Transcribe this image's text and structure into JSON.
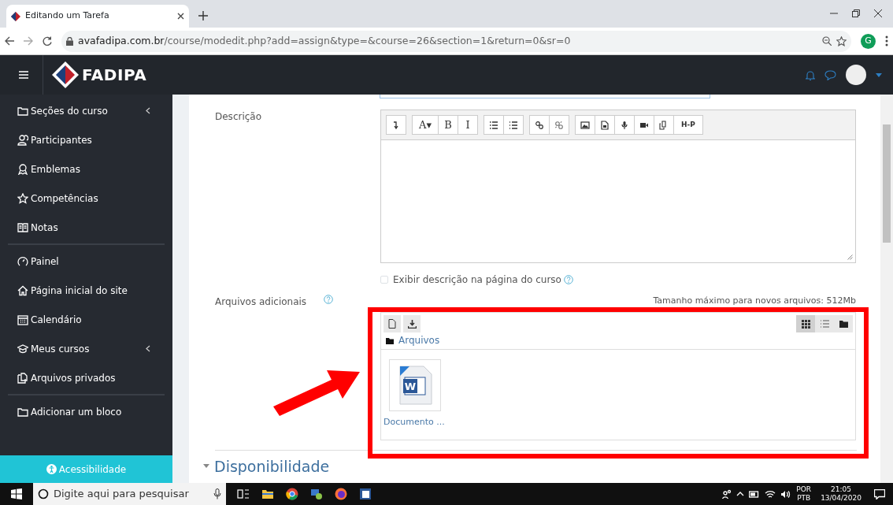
{
  "browser": {
    "tab_title": "Editando um Tarefa",
    "address_host": "avafadipa.com.br",
    "address_path": "/course/modedit.php?add=assign&type=&course=26&section=1&return=0&sr=0",
    "profile_letter": "G"
  },
  "navbar": {
    "brand": "FADIPA"
  },
  "sidebar": {
    "groups": [
      [
        {
          "label": "Seções do curso",
          "expandable": true
        },
        {
          "label": "Participantes",
          "expandable": false
        },
        {
          "label": "Emblemas",
          "expandable": false
        },
        {
          "label": "Competências",
          "expandable": false
        },
        {
          "label": "Notas",
          "expandable": false
        }
      ],
      [
        {
          "label": "Painel",
          "expandable": false
        },
        {
          "label": "Página inicial do site",
          "expandable": false
        },
        {
          "label": "Calendário",
          "expandable": false
        },
        {
          "label": "Meus cursos",
          "expandable": true
        },
        {
          "label": "Arquivos privados",
          "expandable": false
        }
      ],
      [
        {
          "label": "Adicionar um bloco",
          "expandable": false
        }
      ]
    ],
    "accessibility": "Acessibilidade"
  },
  "form": {
    "description_label": "Descrição",
    "toolbar": [
      [
        {
          "kind": "icon"
        }
      ],
      [
        {
          "kind": "text",
          "label": "A▾"
        },
        {
          "kind": "text",
          "label": "B"
        },
        {
          "kind": "text",
          "label": "I"
        }
      ],
      [
        {
          "kind": "icon"
        },
        {
          "kind": "icon"
        }
      ],
      [
        {
          "kind": "icon"
        },
        {
          "kind": "icon"
        }
      ],
      [
        {
          "kind": "icon"
        },
        {
          "kind": "icon"
        },
        {
          "kind": "icon"
        },
        {
          "kind": "icon"
        },
        {
          "kind": "icon"
        },
        {
          "kind": "text",
          "label": "H-P"
        }
      ]
    ],
    "show_description": {
      "label": "Exibir descrição na página do curso",
      "checked": false
    },
    "files_label": "Arquivos adicionais",
    "max_size": "Tamanho máximo para novos arquivos: 512Mb",
    "view_modes": [
      {
        "selected": true
      },
      {
        "selected": false
      },
      {
        "selected": false
      }
    ],
    "path": "Arquivos",
    "files": [
      {
        "name": "Documento ...",
        "icon_letter": "W"
      }
    ],
    "section": {
      "title": "Disponibilidade",
      "expanded": true
    }
  },
  "taskbar": {
    "search_placeholder": "Digite aqui para pesquisar",
    "lang_top": "POR",
    "lang_bottom": "PTB",
    "time": "21:05",
    "date": "13/04/2020"
  }
}
